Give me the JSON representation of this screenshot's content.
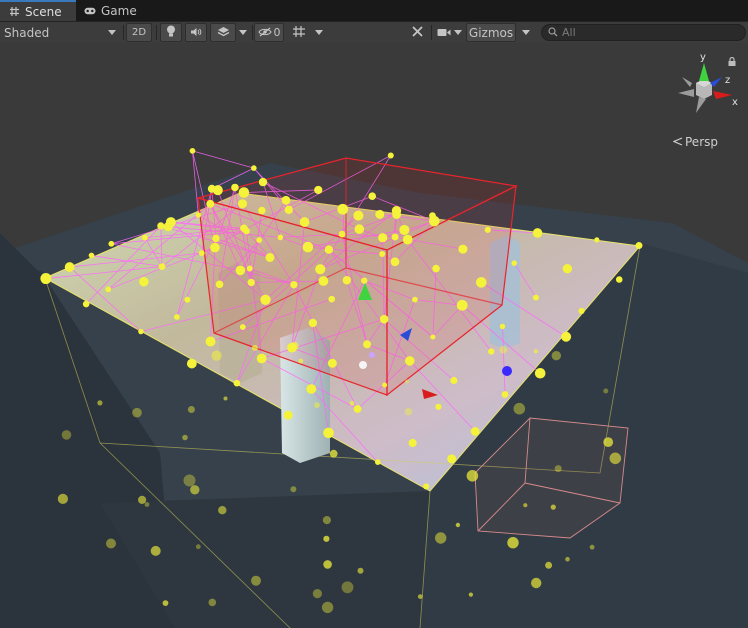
{
  "tabs": [
    {
      "label": "Scene",
      "icon": "hash-icon",
      "active": true
    },
    {
      "label": "Game",
      "icon": "gamepad-icon",
      "active": false
    }
  ],
  "toolbar": {
    "draw_mode": "Shaded",
    "mode_2d": "2D",
    "hidden_count": "0",
    "gizmos_label": "Gizmos",
    "search_placeholder": "All"
  },
  "orientation_gizmo": {
    "x_label": "x",
    "y_label": "y",
    "z_label": "z",
    "projection_label": "Persp"
  },
  "colors": {
    "probe": "#f4f23a",
    "wireframe": "#ff5aff",
    "reflection_box": "#e8242c",
    "ground": "#3b4550",
    "background": "#383838"
  }
}
